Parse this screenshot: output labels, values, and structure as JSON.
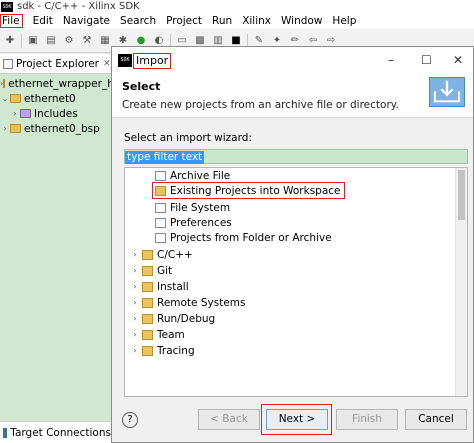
{
  "window": {
    "title": "sdk - C/C++ - Xilinx SDK",
    "app_icon": "SDK"
  },
  "menu": [
    "File",
    "Edit",
    "Navigate",
    "Search",
    "Project",
    "Run",
    "Xilinx",
    "Window",
    "Help"
  ],
  "project_explorer": {
    "title": "Project Explorer",
    "items": [
      {
        "label": "ethernet_wrapper_h",
        "level": 0,
        "expanded": false
      },
      {
        "label": "ethernet0",
        "level": 0,
        "expanded": true
      },
      {
        "label": "Includes",
        "level": 1,
        "expanded": false
      },
      {
        "label": "ethernet0_bsp",
        "level": 0,
        "expanded": false
      }
    ]
  },
  "target_connections": {
    "title": "Target Connections"
  },
  "dialog": {
    "title": "Impor",
    "icon": "SDK",
    "banner_title": "Select",
    "banner_desc": "Create new projects from an archive file or directory.",
    "wizard_label": "Select an import wizard:",
    "filter_text": "type filter text",
    "tree": [
      {
        "label": "Archive File",
        "icon": "doc",
        "indent": 2
      },
      {
        "label": "Existing Projects into Workspace",
        "icon": "fold",
        "indent": 2,
        "selected": true
      },
      {
        "label": "File System",
        "icon": "doc",
        "indent": 2
      },
      {
        "label": "Preferences",
        "icon": "doc",
        "indent": 2
      },
      {
        "label": "Projects from Folder or Archive",
        "icon": "doc",
        "indent": 2
      },
      {
        "label": "C/C++",
        "icon": "fold",
        "indent": 1,
        "arrow": true
      },
      {
        "label": "Git",
        "icon": "fold",
        "indent": 1,
        "arrow": true
      },
      {
        "label": "Install",
        "icon": "fold",
        "indent": 1,
        "arrow": true
      },
      {
        "label": "Remote Systems",
        "icon": "fold",
        "indent": 1,
        "arrow": true
      },
      {
        "label": "Run/Debug",
        "icon": "fold",
        "indent": 1,
        "arrow": true
      },
      {
        "label": "Team",
        "icon": "fold",
        "indent": 1,
        "arrow": true
      },
      {
        "label": "Tracing",
        "icon": "fold",
        "indent": 1,
        "arrow": true
      }
    ],
    "buttons": {
      "help": "?",
      "back": "< Back",
      "next": "Next >",
      "finish": "Finish",
      "cancel": "Cancel"
    }
  }
}
